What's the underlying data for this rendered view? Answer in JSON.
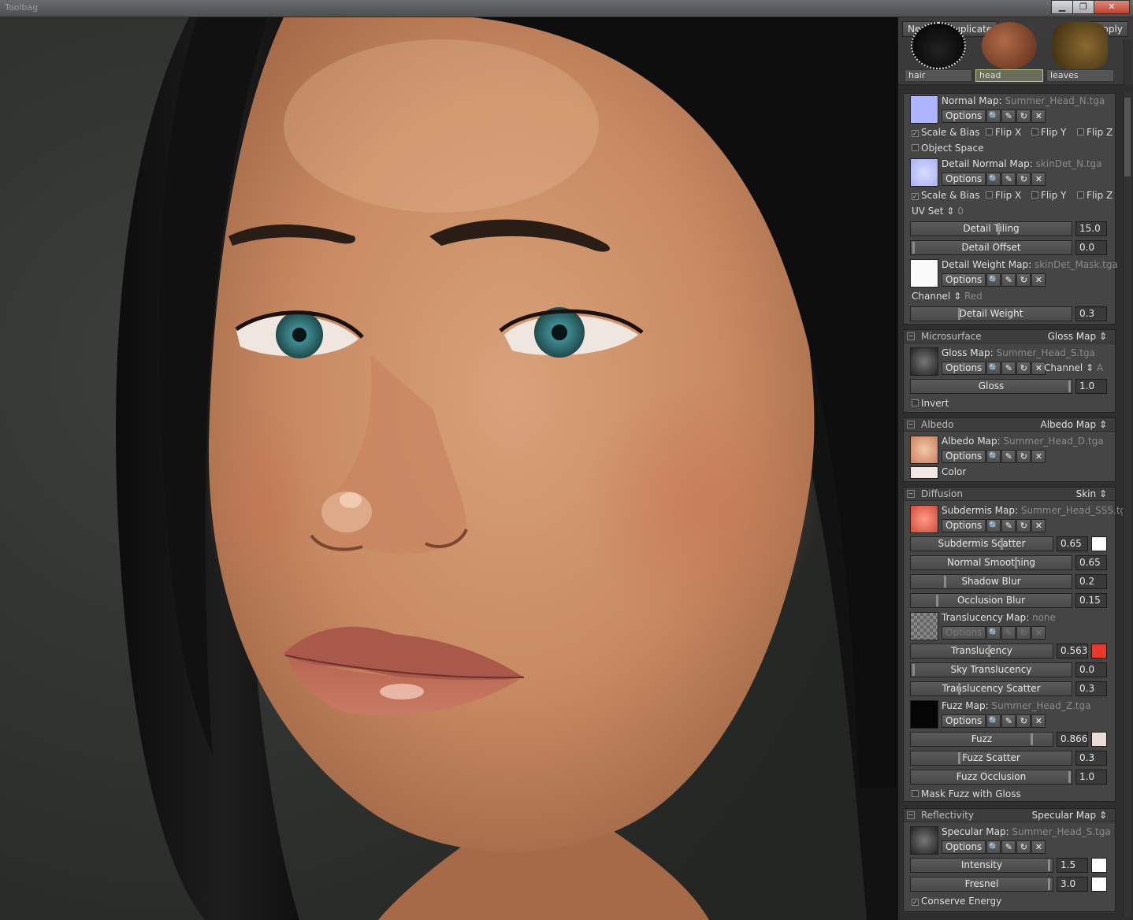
{
  "window": {
    "title": "Toolbag",
    "minimize": "▁",
    "restore": "❐",
    "close": "✕"
  },
  "toolbar": {
    "new_label": "New",
    "duplicate_label": "Duplicate",
    "menu_icon": "≡▾",
    "apply_label": "Apply"
  },
  "materials": [
    {
      "label": "hair"
    },
    {
      "label": "head"
    },
    {
      "label": "leaves"
    }
  ],
  "common": {
    "options": "Options",
    "search_icon": "🔍",
    "edit_icon": "✎",
    "reload_icon": "↻",
    "clear_icon": "✕"
  },
  "surface": {
    "normal_map_label": "Normal Map:",
    "normal_map_file": "Summer_Head_N.tga",
    "scale_bias": "Scale & Bias",
    "flip_x": "Flip X",
    "flip_y": "Flip Y",
    "flip_z": "Flip Z",
    "object_space": "Object Space",
    "detail_normal_label": "Detail Normal Map:",
    "detail_normal_file": "skinDet_N.tga",
    "uv_set_label": "UV Set",
    "uv_set_value": "0",
    "detail_tiling_label": "Detail Tiling",
    "detail_tiling_value": "15.0",
    "detail_offset_label": "Detail Offset",
    "detail_offset_value": "0.0",
    "detail_weight_map_label": "Detail Weight Map:",
    "detail_weight_map_file": "skinDet_Mask.tga",
    "channel_label": "Channel",
    "channel_value": "Red",
    "detail_weight_label": "Detail Weight",
    "detail_weight_value": "0.3"
  },
  "microsurface": {
    "title": "Microsurface",
    "mode": "Gloss Map",
    "map_label": "Gloss Map:",
    "map_file": "Summer_Head_S.tga",
    "channel_label": "Channel",
    "channel_value": "A",
    "gloss_label": "Gloss",
    "gloss_value": "1.0",
    "invert": "Invert"
  },
  "albedo": {
    "title": "Albedo",
    "mode": "Albedo Map",
    "map_label": "Albedo Map:",
    "map_file": "Summer_Head_D.tga",
    "color_label": "Color"
  },
  "diffusion": {
    "title": "Diffusion",
    "mode": "Skin",
    "subdermis_label": "Subdermis Map:",
    "subdermis_file": "Summer_Head_SSS.tga",
    "subdermis_scatter_label": "Subdermis Scatter",
    "subdermis_scatter_value": "0.65",
    "normal_smoothing_label": "Normal Smoothing",
    "normal_smoothing_value": "0.65",
    "shadow_blur_label": "Shadow Blur",
    "shadow_blur_value": "0.2",
    "occlusion_blur_label": "Occlusion Blur",
    "occlusion_blur_value": "0.15",
    "translucency_map_label": "Translucency Map:",
    "translucency_map_file": "none",
    "translucency_label": "Translucency",
    "translucency_value": "0.563",
    "sky_translucency_label": "Sky Translucency",
    "sky_translucency_value": "0.0",
    "translucency_scatter_label": "Translucency Scatter",
    "translucency_scatter_value": "0.3",
    "fuzz_map_label": "Fuzz Map:",
    "fuzz_map_file": "Summer_Head_Z.tga",
    "fuzz_label": "Fuzz",
    "fuzz_value": "0.866",
    "fuzz_scatter_label": "Fuzz Scatter",
    "fuzz_scatter_value": "0.3",
    "fuzz_occlusion_label": "Fuzz Occlusion",
    "fuzz_occlusion_value": "1.0",
    "mask_fuzz": "Mask Fuzz with Gloss"
  },
  "reflectivity": {
    "title": "Reflectivity",
    "mode": "Specular Map",
    "map_label": "Specular Map:",
    "map_file": "Summer_Head_S.tga",
    "intensity_label": "Intensity",
    "intensity_value": "1.5",
    "fresnel_label": "Fresnel",
    "fresnel_value": "3.0",
    "conserve": "Conserve Energy"
  },
  "colors": {
    "translucency_swatch": "#e8392b",
    "albedo_color": "#f1e6e2",
    "fuzz_color": "#eadcd8",
    "accent_selected": "#b3c486"
  }
}
